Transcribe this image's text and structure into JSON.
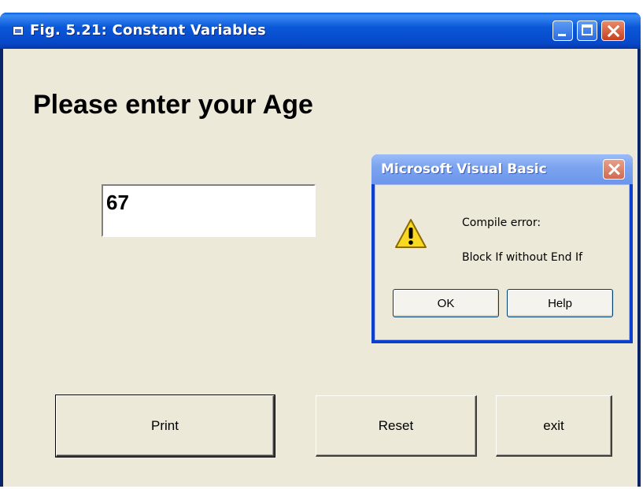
{
  "window": {
    "title": "Fig. 5.21: Constant Variables"
  },
  "main": {
    "heading": "Please enter your Age",
    "age_value": "67",
    "buttons": {
      "print": "Print",
      "reset": "Reset",
      "exit": "exit"
    }
  },
  "dialog": {
    "title": "Microsoft Visual Basic",
    "message_line1": "Compile error:",
    "message_line2": "Block If without End If",
    "icon": "warning-icon",
    "buttons": {
      "ok": "OK",
      "help": "Help"
    }
  },
  "colors": {
    "titlebar": "#0a58d8",
    "client_bg": "#ece9d8",
    "close_button": "#c8401e",
    "dialog_titlebar": "#7ca4f0",
    "warning_fill": "#f8d820"
  }
}
